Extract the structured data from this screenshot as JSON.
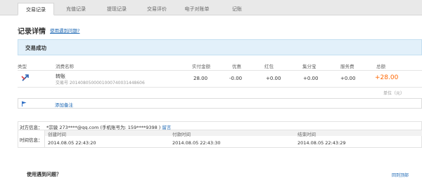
{
  "tabs": [
    {
      "label": "交易记录",
      "active": true
    },
    {
      "label": "充值记录",
      "active": false
    },
    {
      "label": "提现记录",
      "active": false
    },
    {
      "label": "交易评价",
      "active": false
    },
    {
      "label": "电子对账单",
      "active": false
    },
    {
      "label": "记账",
      "active": false
    }
  ],
  "page": {
    "title": "记录详情",
    "help_link": "使用遇到问题?"
  },
  "banner": {
    "status": "交易成功"
  },
  "table": {
    "headers": [
      "类型",
      "消费名称",
      "实付金额",
      "优惠",
      "红包",
      "集分宝",
      "服务费",
      "总额"
    ],
    "row": {
      "name": "转账",
      "order_no": "交易号 2014080500001000740031448606",
      "paid": "28.00",
      "discount": "-0.00",
      "redpacket": "+0.00",
      "jifenbao": "+0.00",
      "fee": "+0.00",
      "total": "+28.00"
    },
    "unit_note": "单位（元）"
  },
  "note": {
    "add_label": "添加备注"
  },
  "info": {
    "party_label": "对方信息：",
    "party_value": "*宗骏 273****@qq.com (手机账号为: 159****9398 )",
    "message_link": "留言",
    "time_label": "时间信息：",
    "time_headers": [
      "创建时间",
      "付款时间",
      "结束时间"
    ],
    "time_values": [
      "2014.08.05 22:43:20",
      "2014.08.05 22:43:30",
      "2014.08.05 22:43:29"
    ]
  },
  "footer": {
    "question_title": "使用遇到问题？",
    "back_top": "回到顶部"
  },
  "colors": {
    "accent_link": "#1a66b3",
    "total_orange": "#ff6600",
    "banner_bg": "#e2f0fa"
  }
}
